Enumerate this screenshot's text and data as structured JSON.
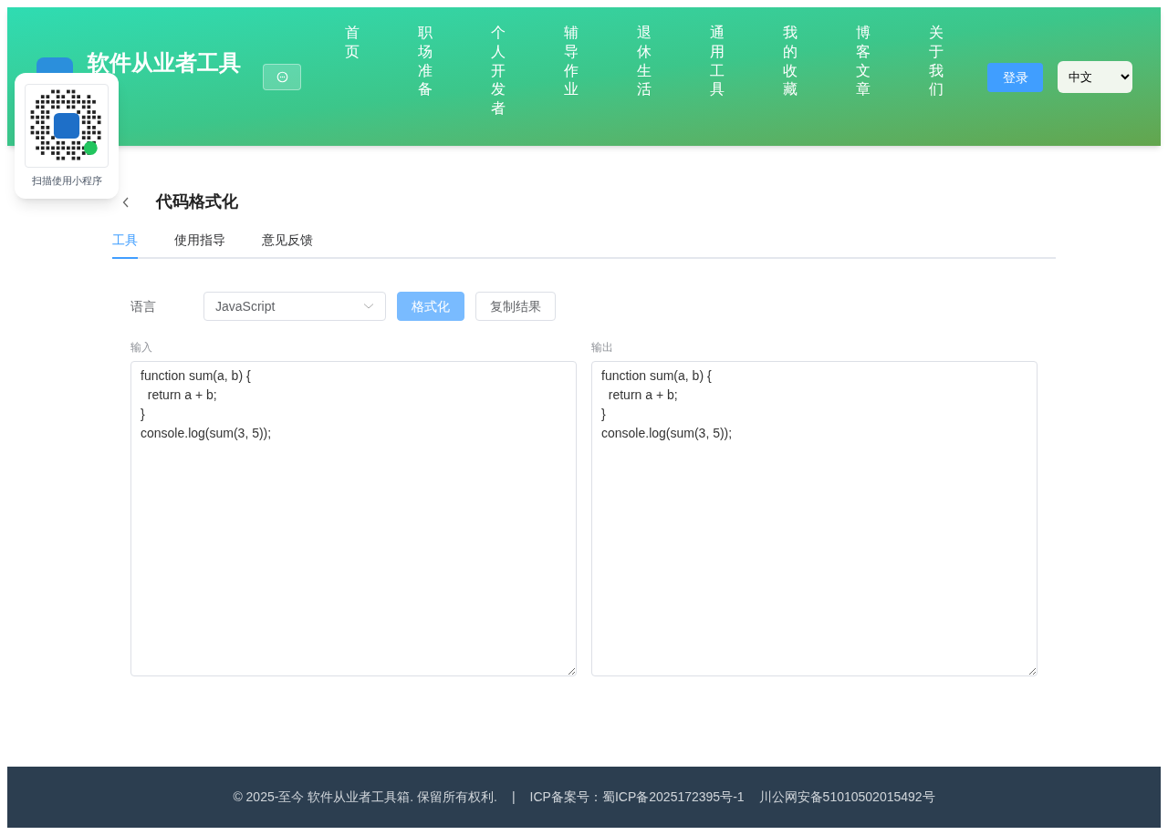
{
  "header": {
    "title": "软件从业者工具",
    "nav": [
      {
        "label": "首页"
      },
      {
        "label": "职场准备"
      },
      {
        "label": "个人开发者"
      },
      {
        "label": "辅导作业"
      },
      {
        "label": "退休生活"
      },
      {
        "label": "通用工具"
      },
      {
        "label": "我的收藏"
      },
      {
        "label": "博客文章"
      },
      {
        "label": "关于我们"
      }
    ],
    "login": "登录",
    "language": "中文"
  },
  "qr_popup": {
    "caption": "扫描使用小程序"
  },
  "page": {
    "title": "代码格式化",
    "tabs": [
      {
        "label": "工具",
        "selected": true
      },
      {
        "label": "使用指导",
        "selected": false
      },
      {
        "label": "意见反馈",
        "selected": false
      }
    ]
  },
  "tool": {
    "language_label": "语言",
    "language": "JavaScript",
    "buttons": [
      {
        "label": "格式化",
        "kind": "primary",
        "disabled": true
      },
      {
        "label": "复制结果",
        "kind": "default",
        "disabled": false
      }
    ],
    "panes": [
      {
        "label": "输入",
        "code": "function sum(a, b) {\n  return a + b;\n}\nconsole.log(sum(3, 5));"
      },
      {
        "label": "输出",
        "code": "function sum(a, b) {\n  return a + b;\n}\nconsole.log(sum(3, 5));"
      }
    ]
  },
  "footer": {
    "copyright": "© 2025-至今 软件从业者工具箱. 保留所有权利.",
    "separator": "|",
    "icp": "ICP备案号：蜀ICP备2025172395号-1",
    "police": "川公网安备51010502015492号"
  }
}
